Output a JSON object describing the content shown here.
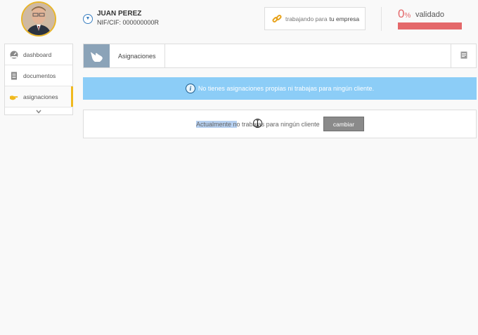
{
  "user": {
    "name": "JUAN PEREZ",
    "nif": "NIF/CIF: 000000000R"
  },
  "company": {
    "prefix": "trabajando para",
    "name": "tu empresa"
  },
  "validation": {
    "percent": "0",
    "percent_sign": "%",
    "label": "validado",
    "progress": 0,
    "bar_color": "#e4686a"
  },
  "sidebar": {
    "items": [
      {
        "label": "dashboard",
        "icon": "gauge-icon"
      },
      {
        "label": "documentos",
        "icon": "document-icon"
      },
      {
        "label": "asignaciones",
        "icon": "hand-pointer-icon",
        "active": true
      }
    ],
    "accent": "#f0b91e"
  },
  "section": {
    "title": "Asignaciones",
    "icon": "hand-pointer-icon",
    "action_icon": "list-document-icon"
  },
  "alert": {
    "text": "No tienes asignaciones propias ni trabajas para ningún cliente.",
    "bg_color": "#8ccdf7"
  },
  "assignment": {
    "status_selected": "Actualmente n",
    "status_rest": "o trabajas para ningún cliente",
    "button_label": "cambiar"
  }
}
